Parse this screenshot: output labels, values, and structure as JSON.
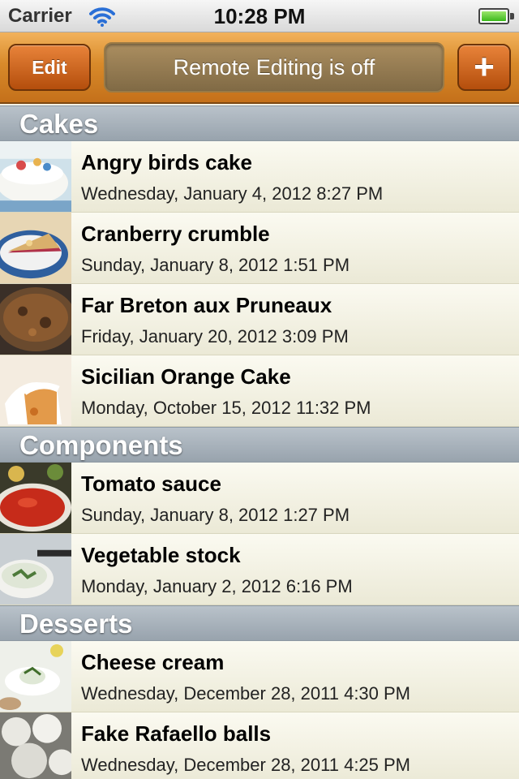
{
  "status_bar": {
    "carrier": "Carrier",
    "time": "10:28 PM",
    "wifi_icon": "wifi-icon",
    "battery_icon": "battery-icon"
  },
  "nav_bar": {
    "edit_label": "Edit",
    "remote_status": "Remote Editing is off",
    "add_label": "+",
    "accent_color": "#c4701a"
  },
  "sections": [
    {
      "title": "Cakes",
      "items": [
        {
          "name": "Angry birds cake",
          "date": "Wednesday, January 4, 2012 8:27 PM"
        },
        {
          "name": "Cranberry crumble",
          "date": "Sunday, January 8, 2012 1:51 PM"
        },
        {
          "name": "Far Breton aux Pruneaux",
          "date": "Friday, January 20, 2012 3:09 PM"
        },
        {
          "name": "Sicilian Orange Cake",
          "date": "Monday, October 15, 2012 11:32 PM"
        }
      ]
    },
    {
      "title": "Components",
      "items": [
        {
          "name": "Tomato sauce",
          "date": "Sunday, January 8, 2012 1:27 PM"
        },
        {
          "name": "Vegetable stock",
          "date": "Monday, January 2, 2012 6:16 PM"
        }
      ]
    },
    {
      "title": "Desserts",
      "items": [
        {
          "name": "Cheese cream",
          "date": "Wednesday, December 28, 2011 4:30 PM"
        },
        {
          "name": "Fake Rafaello balls",
          "date": "Wednesday, December 28, 2011 4:25 PM"
        }
      ]
    }
  ]
}
